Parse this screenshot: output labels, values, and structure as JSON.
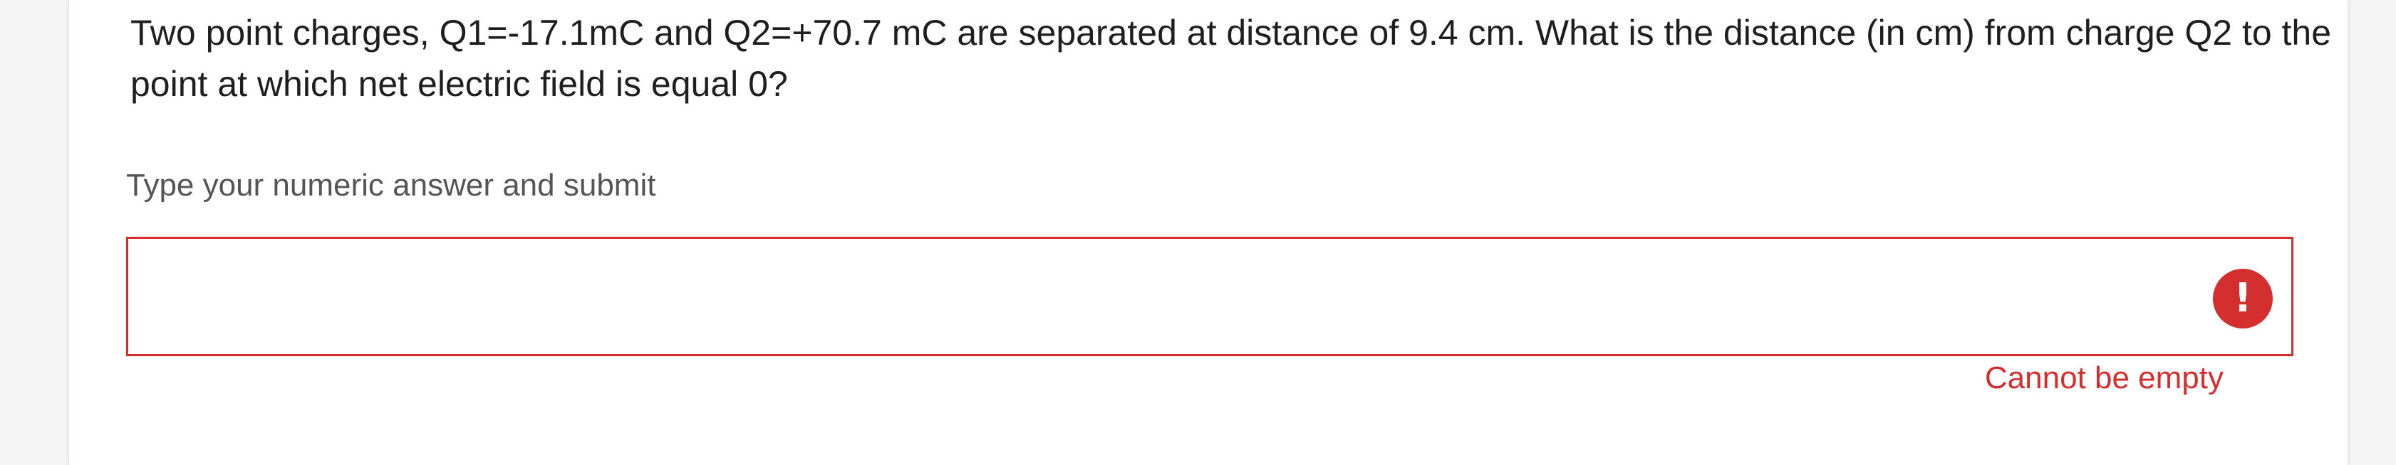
{
  "question": {
    "text": "Two point charges, Q1=-17.1mC and Q2=+70.7 mC are separated at distance of 9.4 cm. What is the distance (in cm) from charge Q2 to the point at which net electric field is equal 0?"
  },
  "answer": {
    "instruction": "Type your numeric answer and submit",
    "value": "",
    "error_icon_glyph": "!",
    "error_message": "Cannot be empty"
  },
  "colors": {
    "error": "#d32f2f",
    "text": "#1f1f1f",
    "muted_text": "#555555"
  },
  "icons": {
    "error": "exclamation-circle-icon"
  }
}
